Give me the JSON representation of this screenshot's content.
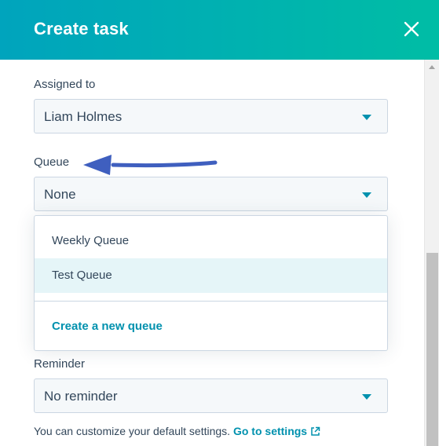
{
  "header": {
    "title": "Create task",
    "close_icon": "close-icon"
  },
  "form": {
    "assigned_to": {
      "label": "Assigned to",
      "value": "Liam Holmes"
    },
    "queue": {
      "label": "Queue",
      "value": "None",
      "options": [
        "Weekly Queue",
        "Test Queue"
      ],
      "highlighted_option": "Test Queue",
      "create_link": "Create a new queue"
    },
    "reminder": {
      "label": "Reminder",
      "value": "No reminder"
    },
    "hint": {
      "text": "You can customize your default settings.",
      "link": "Go to settings",
      "link_icon": "external-link-icon"
    }
  },
  "annotation": {
    "type": "arrow",
    "color": "#3f5fbf",
    "points_to": "Queue"
  },
  "colors": {
    "header_start": "#00a4bd",
    "header_end": "#00bda5",
    "accent": "#0091ae",
    "text": "#33475b",
    "field_bg": "#f5f8fa",
    "field_border": "#cbd6e2",
    "hover_bg": "#e5f5f8"
  }
}
